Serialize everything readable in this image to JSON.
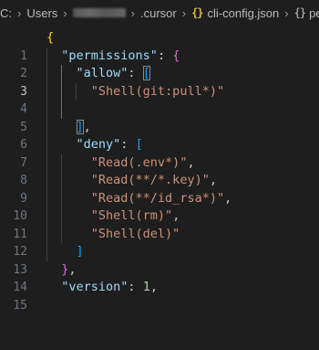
{
  "breadcrumb": {
    "drive": "C:",
    "users": "Users",
    "folder": ".cursor",
    "file_icon": "{}",
    "file": "cli-config.json",
    "symbol_icon": "{}",
    "symbol": "pe"
  },
  "editor": {
    "active_line": 3,
    "lines": [
      {
        "num": "1"
      },
      {
        "num": "2",
        "key": "\"permissions\""
      },
      {
        "num": "3",
        "key": "\"allow\""
      },
      {
        "num": "4",
        "str": "\"Shell(git:pull*)\""
      },
      {
        "num": "5"
      },
      {
        "num": "6"
      },
      {
        "num": "7",
        "key": "\"deny\""
      },
      {
        "num": "8",
        "str": "\"Read(.env*)\""
      },
      {
        "num": "9",
        "str": "\"Read(**/*.key)\""
      },
      {
        "num": "10",
        "str": "\"Read(**/id_rsa*)\""
      },
      {
        "num": "11",
        "str": "\"Shell(rm)\""
      },
      {
        "num": "12",
        "str": "\"Shell(del)\""
      },
      {
        "num": "13"
      },
      {
        "num": "14"
      },
      {
        "num": "15",
        "key": "\"version\"",
        "num_value": "1"
      }
    ]
  },
  "colors": {
    "background": "#1e1e1e",
    "key": "#9cdcfe",
    "string": "#ce9178",
    "number": "#b5cea8",
    "bracket_level1": "#ffd700",
    "bracket_level2": "#da70d6",
    "bracket_level3": "#179fff"
  }
}
